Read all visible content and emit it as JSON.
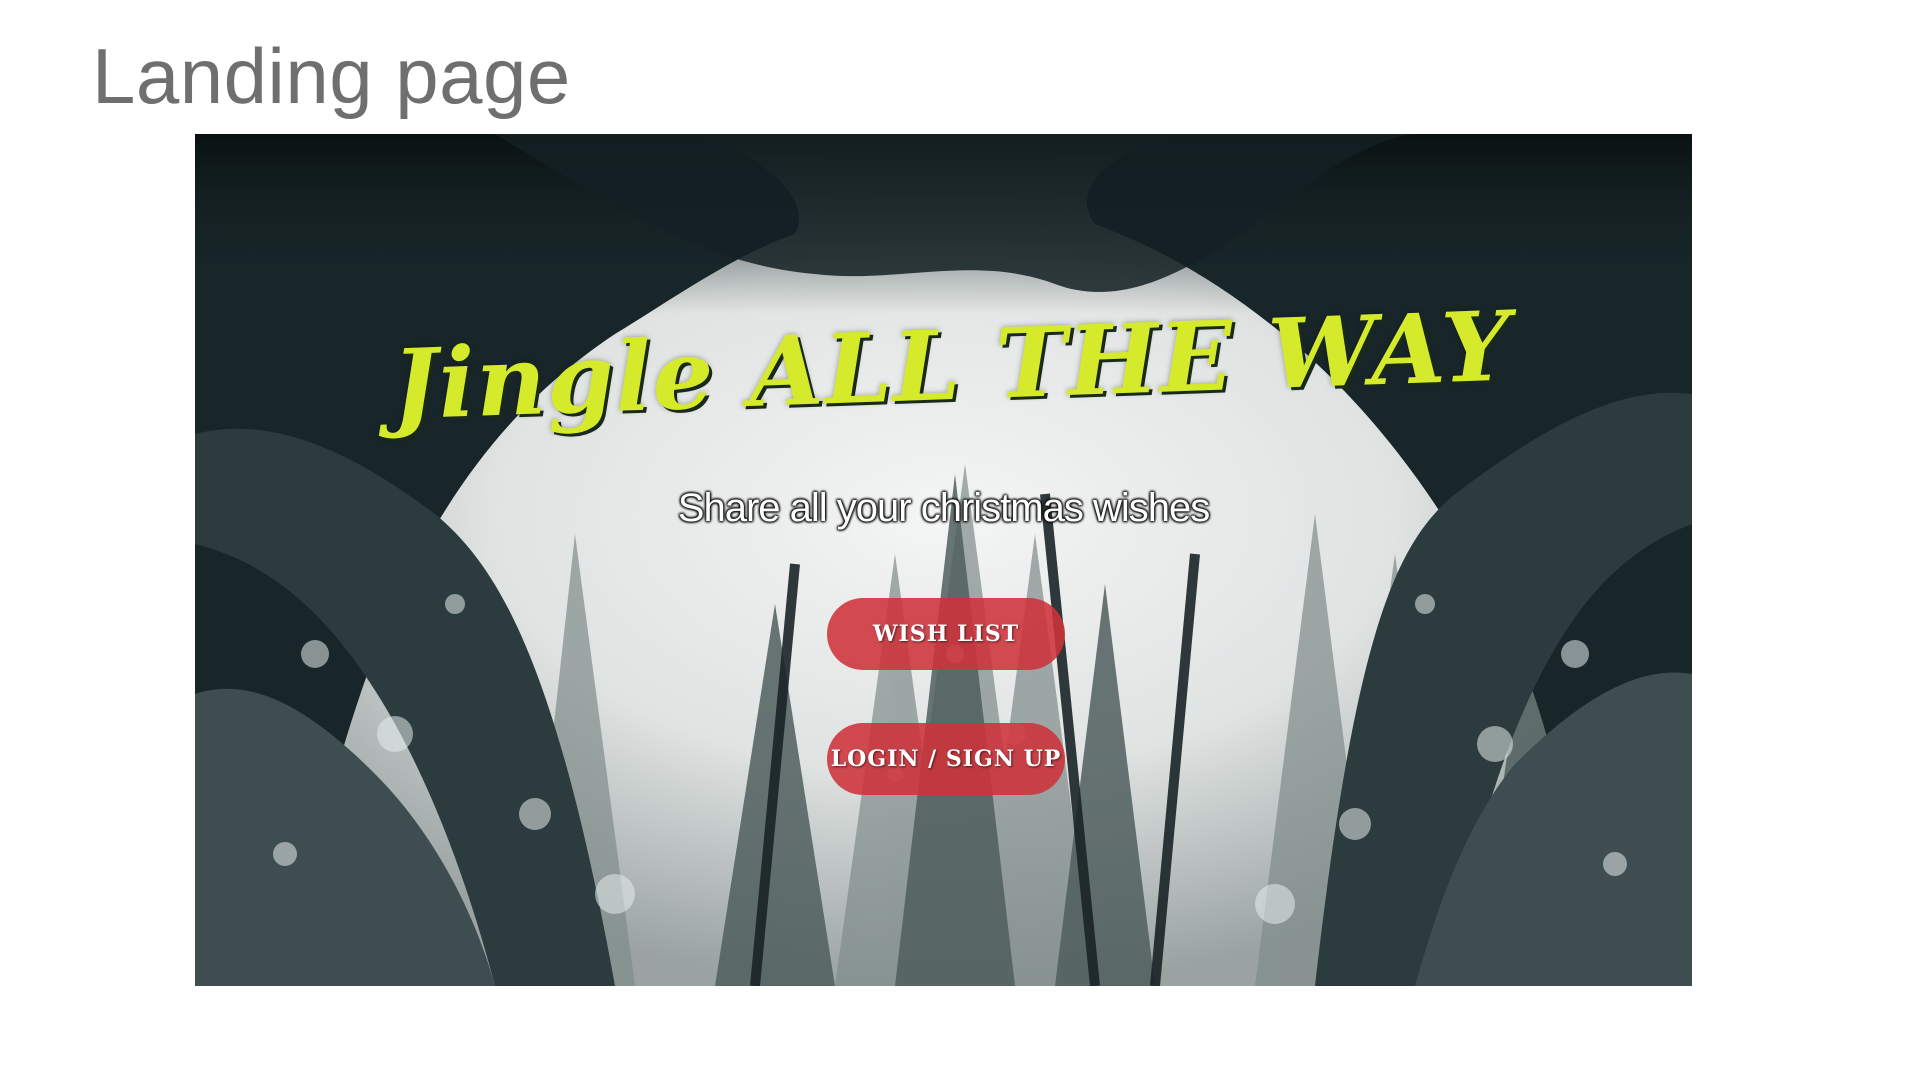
{
  "slide": {
    "title": "Landing page"
  },
  "hero": {
    "heading": "Jingle ALL THE WAY",
    "subtitle": "Share all your christmas wishes",
    "background": "snowy-pine-forest-photo"
  },
  "buttons": {
    "wish_list": "WISH LIST",
    "login_signup": "LOGIN / SIGN UP"
  },
  "colors": {
    "heading": "#d4ea2a",
    "button_bg": "#ce323a",
    "button_text": "#ffffff",
    "slide_title": "#6f6f6f"
  }
}
